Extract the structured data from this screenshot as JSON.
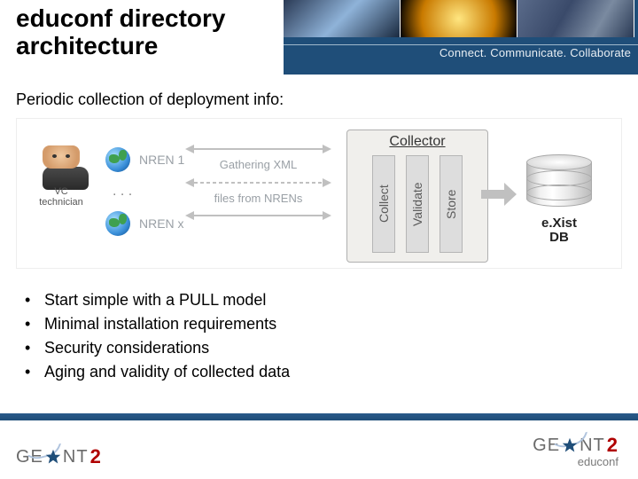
{
  "title": "educonf directory architecture",
  "tagline": "Connect. Communicate. Collaborate",
  "subtitle": "Periodic collection of deployment info:",
  "diagram": {
    "technician_label": "VC\ntechnician",
    "nren_top": "NREN 1",
    "nren_mid": ". . .",
    "nren_bottom": "NREN x",
    "gathering_l1": "Gathering XML",
    "gathering_l2": "files from NRENs",
    "collector_title": "Collector",
    "stage1": "Collect",
    "stage2": "Validate",
    "stage3": "Store",
    "db_l1": "e.Xist",
    "db_l2": "DB"
  },
  "bullets": [
    "Start simple with a PULL model",
    "Minimal installation requirements",
    "Security considerations",
    "Aging and validity of collected data"
  ],
  "footer": {
    "geant": "GE  NT",
    "two": "2",
    "sub": "educonf"
  }
}
